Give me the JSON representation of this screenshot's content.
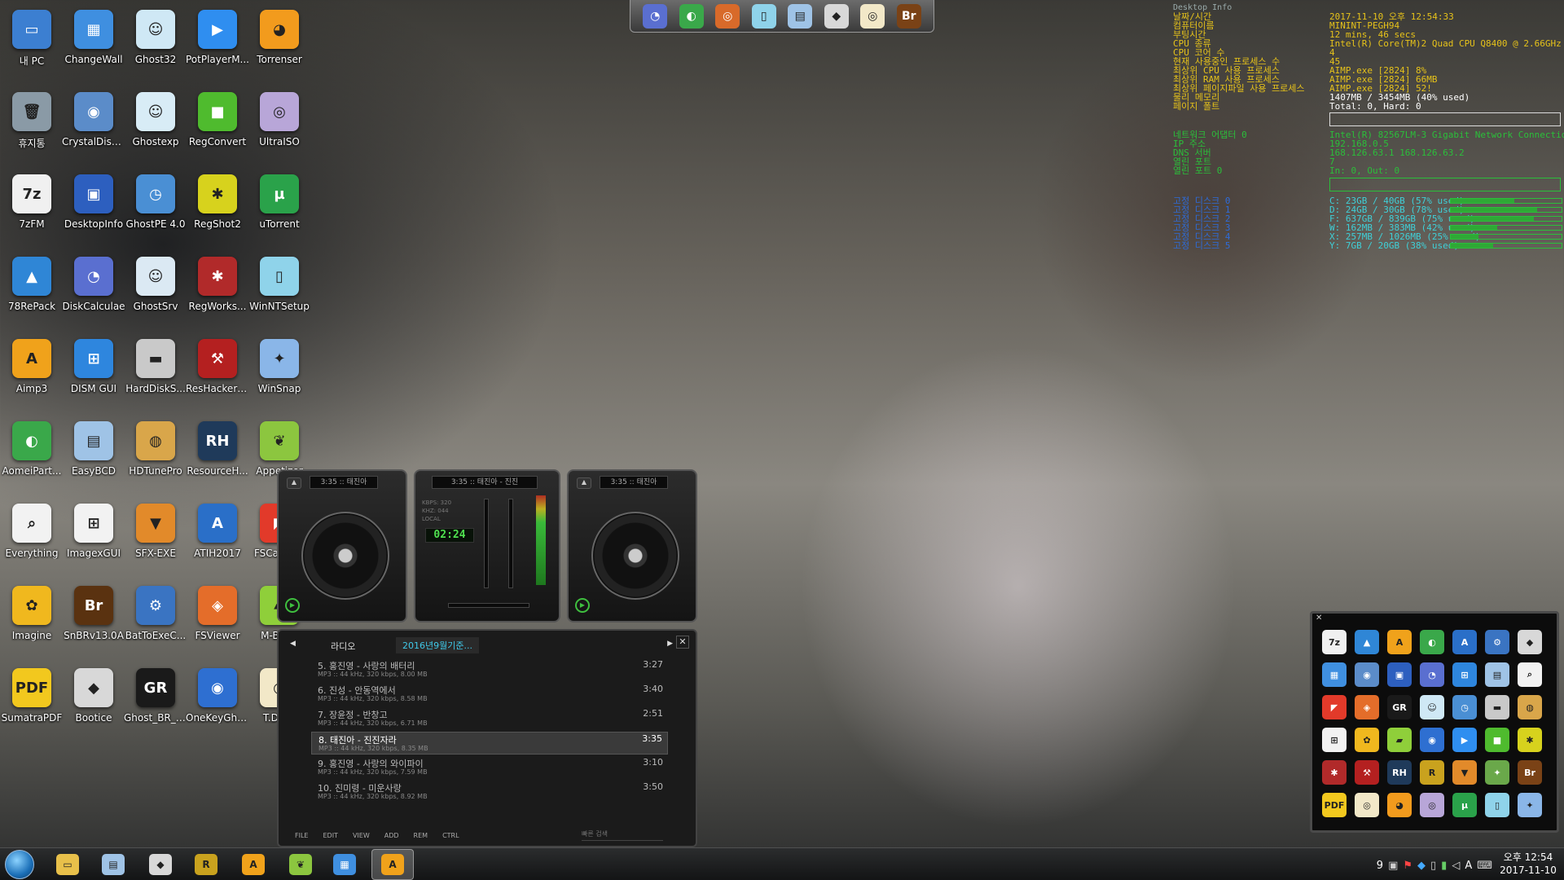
{
  "desktop_icons": [
    {
      "label": "내 PC",
      "glyph": "▭",
      "color": "#3c7fd1"
    },
    {
      "label": "ChangeWall",
      "glyph": "▦",
      "color": "#3f8fe0"
    },
    {
      "label": "Ghost32",
      "glyph": "☺",
      "color": "#cfe8f5"
    },
    {
      "label": "PotPlayerM...",
      "glyph": "▶",
      "color": "#2f8ef0"
    },
    {
      "label": "Torrenser",
      "glyph": "◕",
      "color": "#f29b1d"
    },
    {
      "label": "휴지통",
      "glyph": "🗑",
      "color": "#8a9aa6"
    },
    {
      "label": "CrystalDisk...",
      "glyph": "◉",
      "color": "#5b8cc9"
    },
    {
      "label": "Ghostexp",
      "glyph": "☺",
      "color": "#d8ecf6"
    },
    {
      "label": "RegConvert",
      "glyph": "■",
      "color": "#4fbb2e"
    },
    {
      "label": "UltraISO",
      "glyph": "◎",
      "color": "#b8a6d8"
    },
    {
      "label": "7zFM",
      "glyph": "7z",
      "color": "#f0f0f0"
    },
    {
      "label": "DesktopInfo",
      "glyph": "▣",
      "color": "#2d5fbf"
    },
    {
      "label": "GhostPE 4.0",
      "glyph": "◷",
      "color": "#4a8fd4"
    },
    {
      "label": "RegShot2",
      "glyph": "✱",
      "color": "#d7d21d"
    },
    {
      "label": "uTorrent",
      "glyph": "µ",
      "color": "#2aa24a"
    },
    {
      "label": "78RePack",
      "glyph": "▲",
      "color": "#2f86d6"
    },
    {
      "label": "DiskCalculae",
      "glyph": "◔",
      "color": "#5a6fd0"
    },
    {
      "label": "GhostSrv",
      "glyph": "☺",
      "color": "#dbe9f3"
    },
    {
      "label": "RegWorks...",
      "glyph": "✱",
      "color": "#b12a2a"
    },
    {
      "label": "WinNTSetup",
      "glyph": "▯",
      "color": "#8fd3ea"
    },
    {
      "label": "Aimp3",
      "glyph": "A",
      "color": "#f0a21b"
    },
    {
      "label": "DISM GUI",
      "glyph": "⊞",
      "color": "#2e86de"
    },
    {
      "label": "HardDiskS...",
      "glyph": "▬",
      "color": "#c9c9c9"
    },
    {
      "label": "ResHackerFX",
      "glyph": "⚒",
      "color": "#b42020"
    },
    {
      "label": "WinSnap",
      "glyph": "✦",
      "color": "#8ab6e8"
    },
    {
      "label": "AomeiPart...",
      "glyph": "◐",
      "color": "#3aa84a"
    },
    {
      "label": "EasyBCD",
      "glyph": "▤",
      "color": "#9fc3e6"
    },
    {
      "label": "HDTunePro",
      "glyph": "◍",
      "color": "#d9a64a"
    },
    {
      "label": "ResourceH...",
      "glyph": "RH",
      "color": "#1f3a5a"
    },
    {
      "label": "Appetizer",
      "glyph": "❦",
      "color": "#8cc63f"
    },
    {
      "label": "Everything",
      "glyph": "⌕",
      "color": "#f2f2f2"
    },
    {
      "label": "ImagexGUI",
      "glyph": "⊞",
      "color": "#f2f2f2"
    },
    {
      "label": "SFX-EXE",
      "glyph": "▼",
      "color": "#e28a2a"
    },
    {
      "label": "ATIH2017",
      "glyph": "A",
      "color": "#2a6fc8"
    },
    {
      "label": "FSCapture",
      "glyph": "◤",
      "color": "#e23a2a"
    },
    {
      "label": "Imagine",
      "glyph": "✿",
      "color": "#f0b81e"
    },
    {
      "label": "SnBRv13.0A",
      "glyph": "Br",
      "color": "#5a3210"
    },
    {
      "label": "BatToExeC...",
      "glyph": "⚙",
      "color": "#3a74c2"
    },
    {
      "label": "FSViewer",
      "glyph": "◈",
      "color": "#e46d2a"
    },
    {
      "label": "M-BRPE",
      "glyph": "▰",
      "color": "#8fcf3a"
    },
    {
      "label": "SumatraPDF",
      "glyph": "PDF",
      "color": "#f2c81e"
    },
    {
      "label": "Bootice",
      "glyph": "◆",
      "color": "#d8d8d8"
    },
    {
      "label": "Ghost_BR_v...",
      "glyph": "GR",
      "color": "#1a1a1a"
    },
    {
      "label": "OneKeyGhost",
      "glyph": "◉",
      "color": "#2e6fd1"
    },
    {
      "label": "T.Dism",
      "glyph": "◎",
      "color": "#f2e8c8"
    }
  ],
  "top_bar": [
    {
      "name": "disk-calc-icon",
      "glyph": "◔",
      "color": "#5a6fd0"
    },
    {
      "name": "aomei-icon",
      "glyph": "◐",
      "color": "#3aa84a"
    },
    {
      "name": "disc-icon",
      "glyph": "◎",
      "color": "#d86a2a"
    },
    {
      "name": "winntsetup-icon",
      "glyph": "▯",
      "color": "#8fd3ea"
    },
    {
      "name": "easybcd-icon",
      "glyph": "▤",
      "color": "#9fc3e6"
    },
    {
      "name": "bootice-icon",
      "glyph": "◆",
      "color": "#d8d8d8"
    },
    {
      "name": "tdism-icon",
      "glyph": "◎",
      "color": "#f2e8c8"
    },
    {
      "name": "snbr-icon",
      "glyph": "Br",
      "color": "#7a4216"
    }
  ],
  "desktop_info": {
    "header": "Desktop Info",
    "rows": [
      {
        "k": "날짜/시간",
        "v": "2017-11-10 오후 12:54:33",
        "kc": "y",
        "vc": "y"
      },
      {
        "k": "컴퓨터이름",
        "v": "MININT-PEGH94",
        "kc": "y",
        "vc": "y"
      },
      {
        "k": "부팅시간",
        "v": "12 mins, 46 secs",
        "kc": "y",
        "vc": "y"
      },
      {
        "k": "CPU 종류",
        "v": "Intel(R) Core(TM)2 Quad CPU    Q8400  @ 2.66GHz",
        "kc": "y",
        "vc": "y"
      },
      {
        "k": "CPU 코어 수",
        "v": "4",
        "kc": "y",
        "vc": "y"
      },
      {
        "k": "현재 사용중인 프로세스 수",
        "v": "45",
        "kc": "y",
        "vc": "y"
      },
      {
        "k": "최상위 CPU 사용 프로세스",
        "v": "AIMP.exe [2824] 8%",
        "kc": "y",
        "vc": "y"
      },
      {
        "k": "최상위 RAM 사용 프로세스",
        "v": "AIMP.exe [2824] 66MB",
        "kc": "y",
        "vc": "y"
      },
      {
        "k": "최상위 페이지파일 사용 프로세스",
        "v": "AIMP.exe [2824] 52!",
        "kc": "y",
        "vc": "y"
      },
      {
        "k": "물리 메모리",
        "v": "1407MB / 3454MB (40% used)",
        "kc": "y",
        "vc": "w"
      },
      {
        "k": "페이지 폴트",
        "v": "Total: 0, Hard: 0",
        "kc": "y",
        "vc": "w"
      },
      {
        "k": "네트워크 어댑터 0",
        "v": "Intel(R) 82567LM-3 Gigabit Network Connection",
        "kc": "g",
        "vc": "g"
      },
      {
        "k": "IP 주소",
        "v": "192.168.0.5",
        "kc": "g",
        "vc": "g"
      },
      {
        "k": "DNS 서버",
        "v": "168.126.63.1 168.126.63.2",
        "kc": "g",
        "vc": "g"
      },
      {
        "k": "열린 포트",
        "v": "7",
        "kc": "g",
        "vc": "g"
      },
      {
        "k": "열린 포트 0",
        "v": "In: 0, Out: 0",
        "kc": "g",
        "vc": "g"
      }
    ],
    "disks": [
      {
        "k": "고정 디스크 0",
        "v": "C: 23GB / 40GB (57% used)",
        "pct": 57
      },
      {
        "k": "고정 디스크 1",
        "v": "D: 24GB / 30GB (78% used)",
        "pct": 78
      },
      {
        "k": "고정 디스크 2",
        "v": "F: 637GB / 839GB (75% used)",
        "pct": 75
      },
      {
        "k": "고정 디스크 3",
        "v": "W: 162MB / 383MB (42% used)",
        "pct": 42
      },
      {
        "k": "고정 디스크 4",
        "v": "X: 257MB / 1026MB (25% used)",
        "pct": 25
      },
      {
        "k": "고정 디스크 5",
        "v": "Y: 7GB / 20GB (38% used)",
        "pct": 38
      }
    ]
  },
  "player": {
    "left_deck_display": "3:35 :: 태진아",
    "mixer_display": "3:35 :: 태진아 - 진진",
    "right_deck_display": "3:35 :: 태진아",
    "time": "02:24",
    "kbps_label": "KBPS:",
    "khz_label": "KHZ:",
    "local_label": "LOCAL",
    "kbps_value": "320",
    "khz_value": "044",
    "tab_radio": "라디오",
    "tab_playlist": "2016년9월기준...",
    "tracks": [
      {
        "title": "5. 홍진영 - 사랑의 배터리",
        "dur": "3:27",
        "meta": "MP3 :: 44 kHz, 320 kbps, 8.00 MB"
      },
      {
        "title": "6. 진성 - 안동역에서",
        "dur": "3:40",
        "meta": "MP3 :: 44 kHz, 320 kbps, 8.58 MB"
      },
      {
        "title": "7. 장윤정 - 반창고",
        "dur": "2:51",
        "meta": "MP3 :: 44 kHz, 320 kbps, 6.71 MB"
      },
      {
        "title": "8. 태진아 - 진진자라",
        "dur": "3:35",
        "meta": "MP3 :: 44 kHz, 320 kbps, 8.35 MB"
      },
      {
        "title": "9. 홍진영 - 사랑의 와이파이",
        "dur": "3:10",
        "meta": "MP3 :: 44 kHz, 320 kbps, 7.59 MB"
      },
      {
        "title": "10. 진미령 - 미운사랑",
        "dur": "3:50",
        "meta": "MP3 :: 44 kHz, 320 kbps, 8.92 MB"
      }
    ],
    "selected_index": 3,
    "footer": [
      "FILE",
      "EDIT",
      "VIEW",
      "ADD",
      "REM",
      "CTRL"
    ],
    "search_placeholder": "빠른 검색"
  },
  "launcher_grid": [
    {
      "glyph": "7z",
      "color": "#f0f0f0"
    },
    {
      "glyph": "▲",
      "color": "#2f86d6"
    },
    {
      "glyph": "A",
      "color": "#f0a21b"
    },
    {
      "glyph": "◐",
      "color": "#3aa84a"
    },
    {
      "glyph": "A",
      "color": "#2a6fc8"
    },
    {
      "glyph": "⚙",
      "color": "#3a74c2"
    },
    {
      "glyph": "◆",
      "color": "#d8d8d8"
    },
    {
      "glyph": "▦",
      "color": "#3f8fe0"
    },
    {
      "glyph": "◉",
      "color": "#5b8cc9"
    },
    {
      "glyph": "▣",
      "color": "#2d5fbf"
    },
    {
      "glyph": "◔",
      "color": "#5a6fd0"
    },
    {
      "glyph": "⊞",
      "color": "#2e86de"
    },
    {
      "glyph": "▤",
      "color": "#9fc3e6"
    },
    {
      "glyph": "⌕",
      "color": "#f2f2f2"
    },
    {
      "glyph": "◤",
      "color": "#e23a2a"
    },
    {
      "glyph": "◈",
      "color": "#e46d2a"
    },
    {
      "glyph": "GR",
      "color": "#1a1a1a"
    },
    {
      "glyph": "☺",
      "color": "#cfe8f5"
    },
    {
      "glyph": "◷",
      "color": "#4a8fd4"
    },
    {
      "glyph": "▬",
      "color": "#c9c9c9"
    },
    {
      "glyph": "◍",
      "color": "#d9a64a"
    },
    {
      "glyph": "⊞",
      "color": "#f2f2f2"
    },
    {
      "glyph": "✿",
      "color": "#f0b81e"
    },
    {
      "glyph": "▰",
      "color": "#8fcf3a"
    },
    {
      "glyph": "◉",
      "color": "#2e6fd1"
    },
    {
      "glyph": "▶",
      "color": "#2f8ef0"
    },
    {
      "glyph": "■",
      "color": "#4fbb2e"
    },
    {
      "glyph": "✱",
      "color": "#d7d21d"
    },
    {
      "glyph": "✱",
      "color": "#b12a2a"
    },
    {
      "glyph": "⚒",
      "color": "#b42020"
    },
    {
      "glyph": "RH",
      "color": "#1f3a5a"
    },
    {
      "glyph": "R",
      "color": "#c9a21e"
    },
    {
      "glyph": "▼",
      "color": "#e28a2a"
    },
    {
      "glyph": "✦",
      "color": "#6aa84a"
    },
    {
      "glyph": "Br",
      "color": "#7a4216"
    },
    {
      "glyph": "PDF",
      "color": "#f2c81e"
    },
    {
      "glyph": "◎",
      "color": "#f2e8c8"
    },
    {
      "glyph": "◕",
      "color": "#f29b1d"
    },
    {
      "glyph": "◎",
      "color": "#b8a6d8"
    },
    {
      "glyph": "µ",
      "color": "#2aa24a"
    },
    {
      "glyph": "▯",
      "color": "#8fd3ea"
    },
    {
      "glyph": "✦",
      "color": "#8ab6e8"
    }
  ],
  "taskbar": {
    "items": [
      {
        "name": "explorer-icon",
        "glyph": "▭",
        "color": "#e8c04a"
      },
      {
        "name": "notepad-icon",
        "glyph": "▤",
        "color": "#9fc3e6"
      },
      {
        "name": "bootice-icon",
        "glyph": "◆",
        "color": "#d8d8d8"
      },
      {
        "name": "reshacker-icon",
        "glyph": "R",
        "color": "#c9a21e"
      },
      {
        "name": "aimp-icon",
        "glyph": "A",
        "color": "#f0a21b"
      },
      {
        "name": "appetizer-icon",
        "glyph": "❦",
        "color": "#8cc63f"
      },
      {
        "name": "changewall-icon",
        "glyph": "▦",
        "color": "#3f8fe0"
      },
      {
        "name": "aimp-active-icon",
        "glyph": "A",
        "color": "#f0a21b"
      }
    ],
    "tray_number": "9",
    "ime": "A",
    "clock_time": "오후 12:54",
    "clock_date": "2017-11-10"
  }
}
